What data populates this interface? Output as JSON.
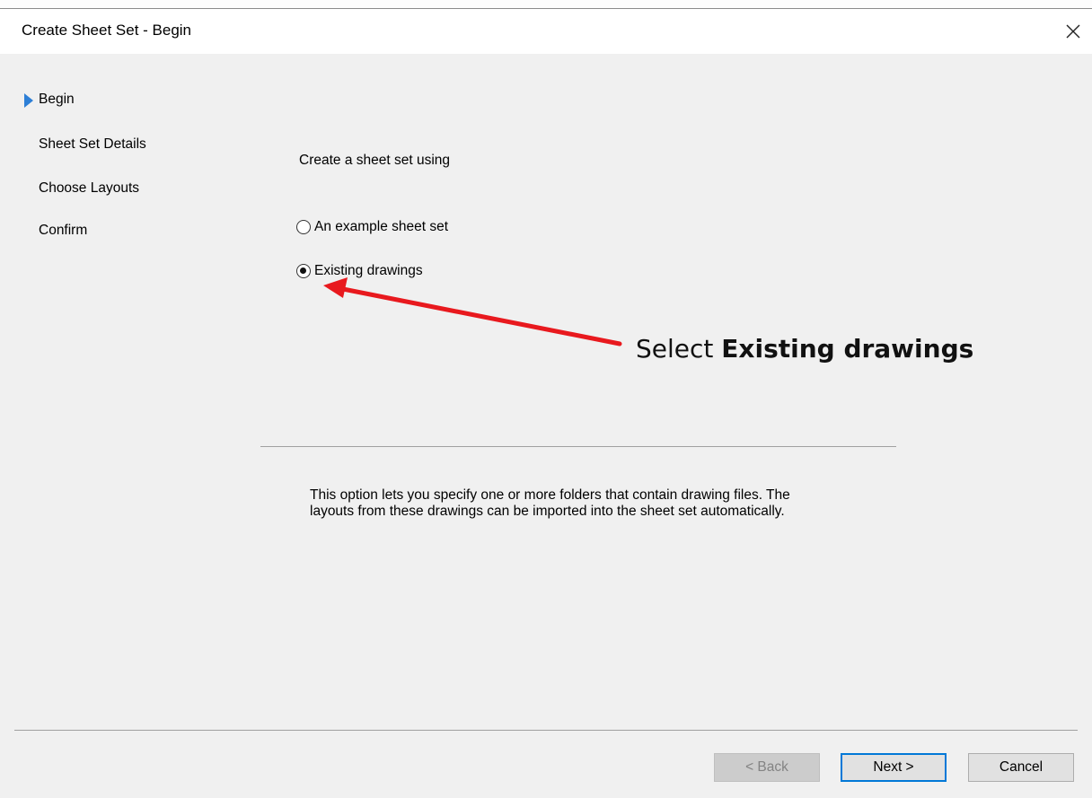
{
  "window": {
    "title": "Create Sheet Set - Begin",
    "close_glyph": "×"
  },
  "nav": {
    "items": [
      {
        "label": "Begin",
        "active": true
      },
      {
        "label": "Sheet Set Details",
        "active": false
      },
      {
        "label": "Choose Layouts",
        "active": false
      },
      {
        "label": "Confirm",
        "active": false
      }
    ],
    "marker_color": "#2d7fd6"
  },
  "main": {
    "prompt": "Create a sheet set using",
    "options": [
      {
        "label": "An example sheet set",
        "selected": false
      },
      {
        "label": "Existing drawings",
        "selected": true
      }
    ],
    "description": "This option lets you specify one or more folders that contain drawing files.  The layouts from these drawings can be imported into the sheet set automatically."
  },
  "buttons": {
    "back": "< Back",
    "next": "Next >",
    "cancel": "Cancel"
  },
  "annotation": {
    "prefix": "Select ",
    "emphasis": "Existing drawings",
    "arrow_color": "#e8191e"
  }
}
